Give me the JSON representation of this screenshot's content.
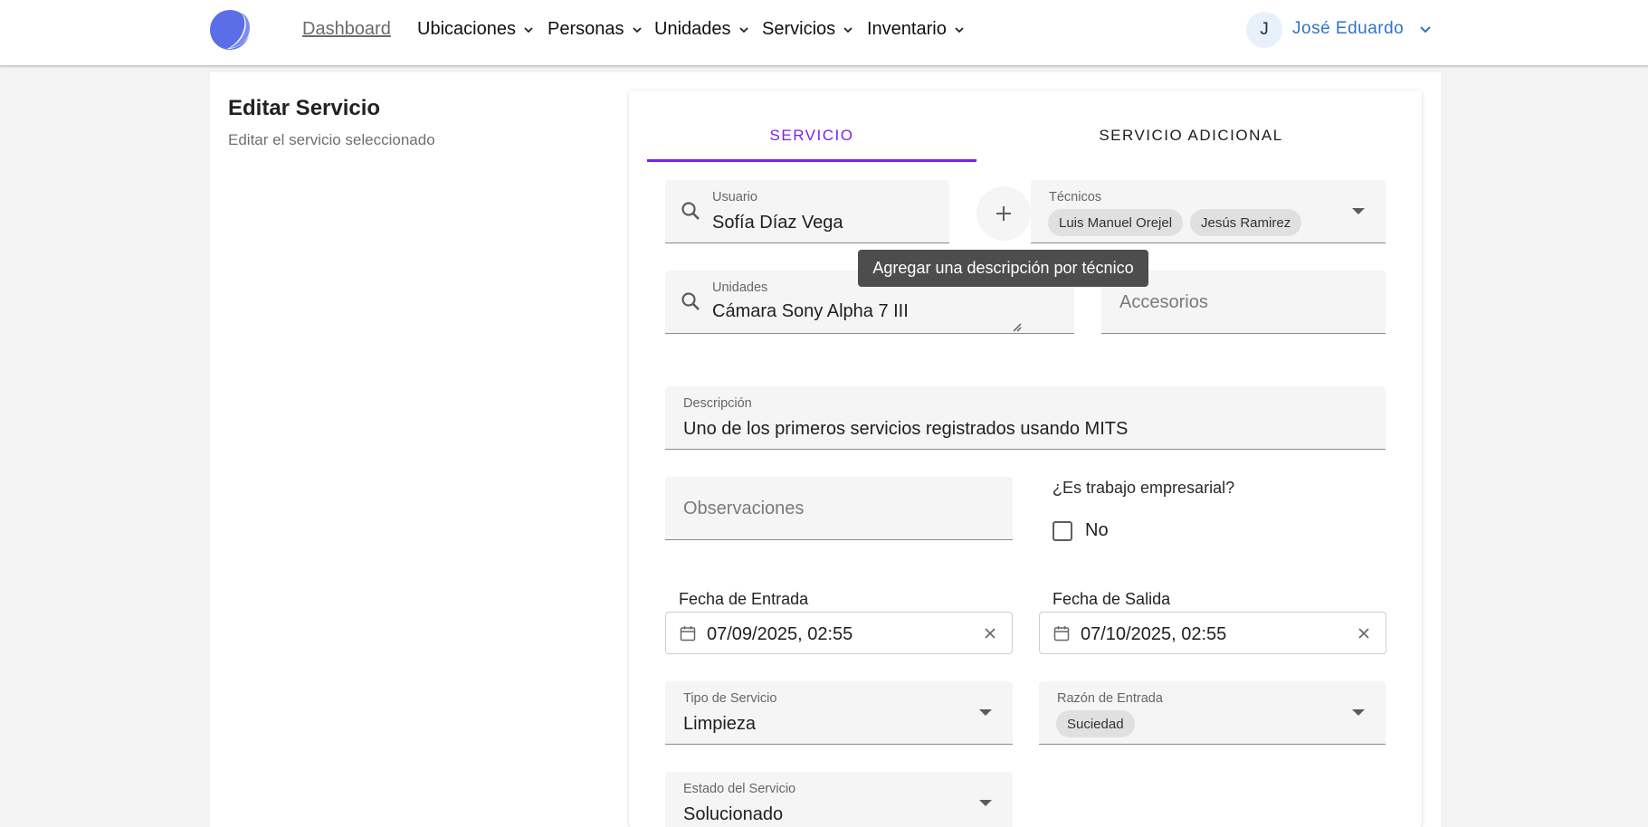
{
  "header": {
    "nav": {
      "dashboard": "Dashboard",
      "ubicaciones": "Ubicaciones",
      "personas": "Personas",
      "unidades": "Unidades",
      "servicios": "Servicios",
      "inventario": "Inventario"
    },
    "user": {
      "initial": "J",
      "name": "José Eduardo"
    }
  },
  "page": {
    "title": "Editar Servicio",
    "subtitle": "Editar el servicio seleccionado"
  },
  "tabs": {
    "servicio": "SERVICIO",
    "adicional": "SERVICIO ADICIONAL"
  },
  "form": {
    "usuario": {
      "label": "Usuario",
      "value": "Sofía Díaz Vega"
    },
    "tecnicos": {
      "label": "Técnicos",
      "chips": [
        "Luis Manuel Orejel",
        "Jesús Ramirez"
      ]
    },
    "tooltip": "Agregar una descripción por técnico",
    "unidades": {
      "label": "Unidades",
      "value": "Cámara Sony Alpha 7 III"
    },
    "accesorios": {
      "placeholder": "Accesorios"
    },
    "descripcion": {
      "label": "Descripción",
      "value": "Uno de los primeros servicios registrados usando MITS"
    },
    "observaciones": {
      "placeholder": "Observaciones"
    },
    "empresarial": {
      "question": "¿Es trabajo empresarial?",
      "checkbox_label": "No",
      "checked": false
    },
    "fecha_entrada": {
      "label": "Fecha de Entrada",
      "value": "07/09/2025, 02:55"
    },
    "fecha_salida": {
      "label": "Fecha de Salida",
      "value": "07/10/2025, 02:55"
    },
    "tipo_servicio": {
      "label": "Tipo de Servicio",
      "value": "Limpieza"
    },
    "razon_entrada": {
      "label": "Razón de Entrada",
      "chip": "Suciedad"
    },
    "estado_servicio": {
      "label": "Estado del Servicio",
      "value": "Solucionado"
    }
  },
  "colors": {
    "accent": "#7c1ff0",
    "user_link": "#2f73c8",
    "logo": "#5b6ee8"
  }
}
